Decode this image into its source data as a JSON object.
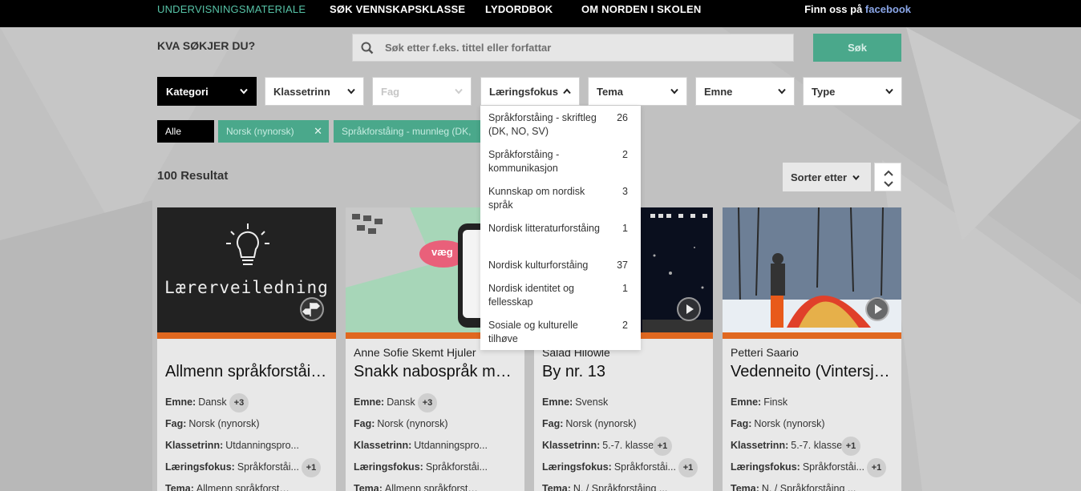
{
  "nav": {
    "items": [
      "UNDERVISNINGSMATERIALE",
      "SØK VENNSKAPSKLASSE",
      "LYDORDBOK",
      "OM NORDEN I SKOLEN"
    ],
    "social_prefix": "Finn oss på",
    "social_link": "facebook"
  },
  "search": {
    "label": "KVA SØKJER DU?",
    "placeholder": "Søk etter f.eks. tittel eller forfattar",
    "button": "Søk"
  },
  "filters": [
    "Kategori",
    "Klassetrinn",
    "Fag",
    "Læringsfokus",
    "Tema",
    "Emne",
    "Type"
  ],
  "chips": {
    "all": "Alle",
    "active": [
      "Norsk (nynorsk)",
      "Språkforståing - munnleg (DK,"
    ]
  },
  "results_label": "100 Resultat",
  "sort_label": "Sorter etter",
  "dropdown": {
    "items": [
      {
        "label": "Språkforståing - skriftleg (DK, NO, SV)",
        "count": "26"
      },
      {
        "label": "Språkforståing - kommunikasjon",
        "count": "2"
      },
      {
        "label": "Kunnskap om nordisk språk",
        "count": "3"
      },
      {
        "label": "Nordisk litteraturforståing",
        "count": "1"
      },
      {
        "label": "Nordisk kulturforståing",
        "count": "37"
      },
      {
        "label": "Nordisk identitet og fellesskap",
        "count": "1"
      },
      {
        "label": "Sosiale og kulturelle tilhøve",
        "count": "2"
      }
    ]
  },
  "meta_labels": {
    "emne": "Emne:",
    "fag": "Fag:",
    "klassetrinn": "Klassetrinn:",
    "laeringsfokus": "Læringsfokus:",
    "tema": "Tema:"
  },
  "cards": [
    {
      "author": "",
      "title": "Allmenn språkforståin...",
      "thumb_text": "Lærerveiledning",
      "emne": "Dansk",
      "emne_more": "+3",
      "fag": "Norsk (nynorsk)",
      "klassetrinn": "Utdanningspro...",
      "klassetrinn_more": "",
      "laeringsfokus": "Språkforståi...",
      "laeringsfokus_more": "+1",
      "tema": "Allmenn språkforståi..."
    },
    {
      "author": "Anne Sofie Skemt Hjuler",
      "title": "Snakk nabospråk med ...",
      "thumb_text": "væg",
      "emne": "Dansk",
      "emne_more": "+3",
      "fag": "Norsk (nynorsk)",
      "klassetrinn": "Utdanningspro...",
      "klassetrinn_more": "",
      "laeringsfokus": "Språkforståi...",
      "laeringsfokus_more": "",
      "tema": "Allmenn språkforståi..."
    },
    {
      "author": "Salad Hilowle",
      "title": "By nr. 13",
      "thumb_text": "",
      "emne": "Svensk",
      "emne_more": "",
      "fag": "Norsk (nynorsk)",
      "klassetrinn": "5.-7. klasse",
      "klassetrinn_more": "+1",
      "laeringsfokus": "Språkforståi...",
      "laeringsfokus_more": "+1",
      "tema": "N. / Språkforståing ..."
    },
    {
      "author": "Petteri Saario",
      "title": "Vedenneito (Vintersjø...",
      "thumb_text": "",
      "emne": "Finsk",
      "emne_more": "",
      "fag": "Norsk (nynorsk)",
      "klassetrinn": "5.-7. klasse",
      "klassetrinn_more": "+1",
      "laeringsfokus": "Språkforståi...",
      "laeringsfokus_more": "+1",
      "tema": "N. / Språkforståing ..."
    }
  ],
  "colors": {
    "accent": "#56c2a6",
    "button": "#4aa88b",
    "stripe": "#e06820"
  }
}
